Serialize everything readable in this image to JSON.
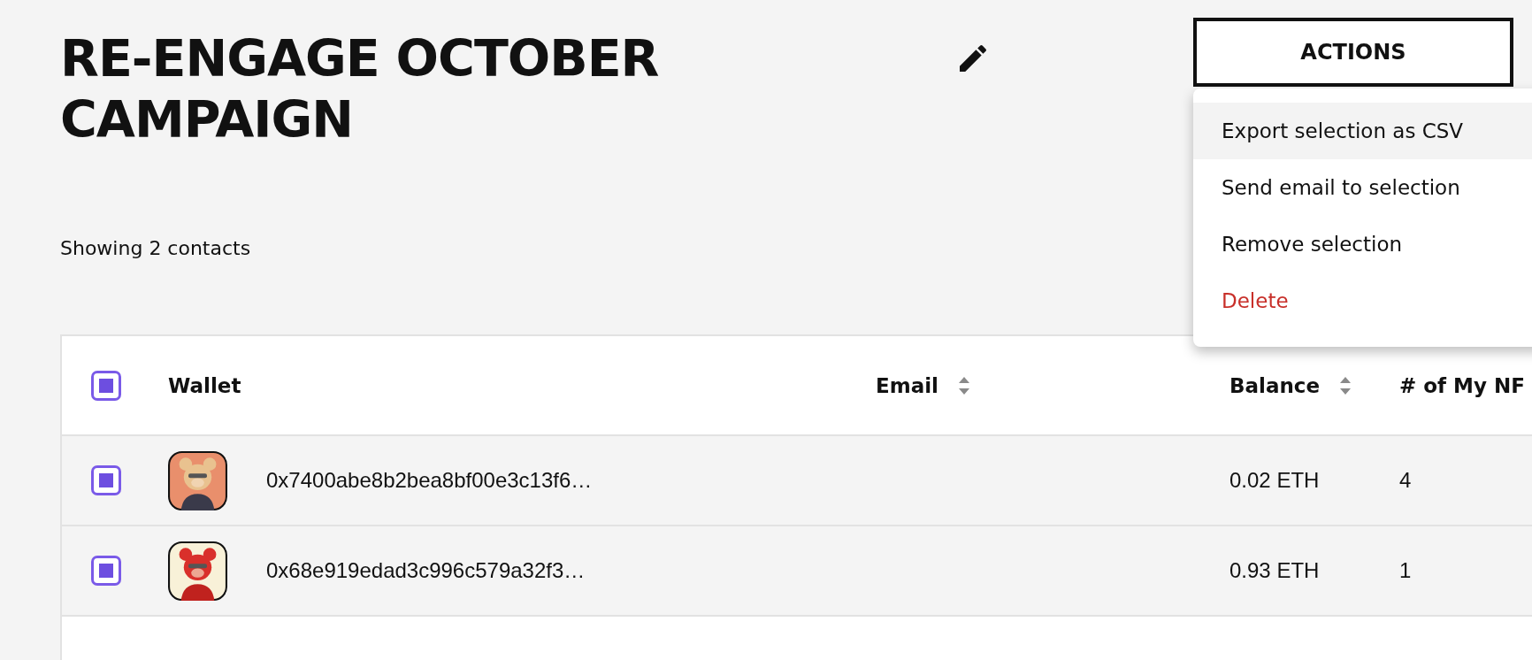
{
  "title": "RE-ENGAGE OCTOBER CAMPAIGN",
  "actions": {
    "label": "ACTIONS",
    "expanded": true,
    "menu": [
      {
        "label": "Export selection as CSV",
        "kind": "normal",
        "selected": true
      },
      {
        "label": "Send email to selection",
        "kind": "normal",
        "selected": false
      },
      {
        "label": "Remove selection",
        "kind": "normal",
        "selected": false
      },
      {
        "label": "Delete",
        "kind": "danger",
        "selected": false
      }
    ]
  },
  "summary": "Showing 2 contacts",
  "table": {
    "select_all": {
      "checked": true
    },
    "columns": [
      {
        "label": "Wallet",
        "sortable": false
      },
      {
        "label": "Email",
        "sortable": true
      },
      {
        "label": "Balance",
        "sortable": true
      },
      {
        "label": "# of My NF"
      }
    ],
    "rows": [
      {
        "checked": true,
        "wallet": "0x7400abe8b2bea8bf00e3c13f6…",
        "balance": "0.02 ETH",
        "nfts": "4"
      },
      {
        "checked": true,
        "wallet": "0x68e919edad3c996c579a32f3…",
        "balance": "0.93 ETH",
        "nfts": "1"
      }
    ]
  }
}
